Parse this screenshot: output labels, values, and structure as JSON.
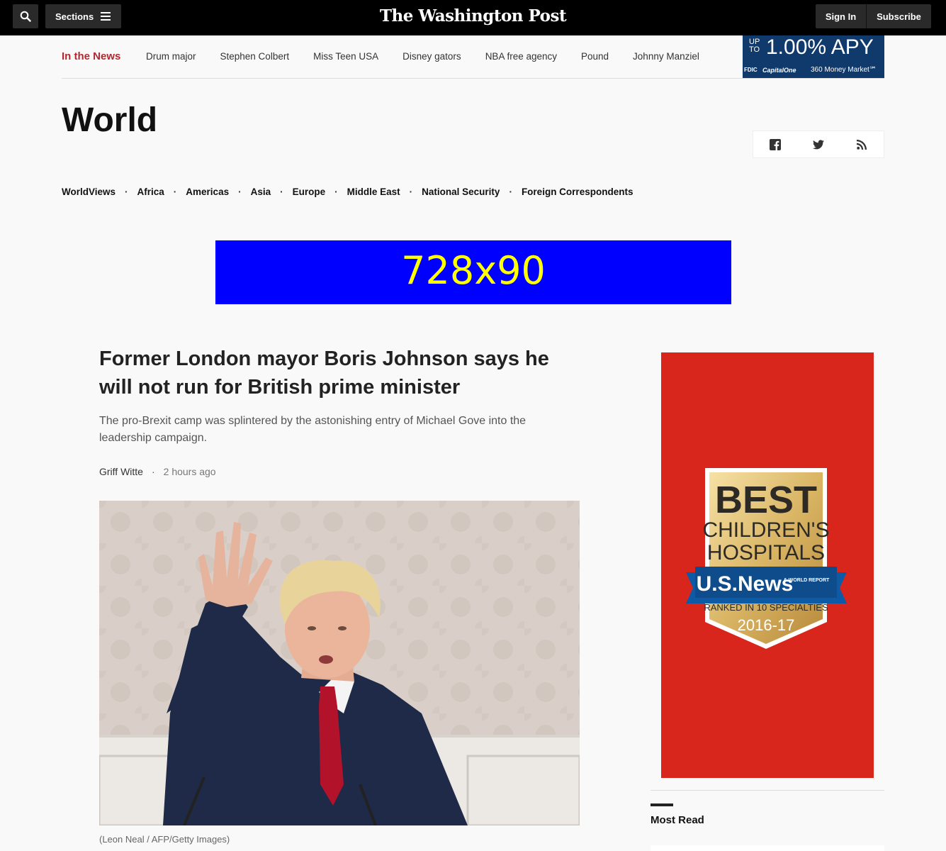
{
  "topbar": {
    "sections_label": "Sections",
    "logo_text": "The Washington Post",
    "signin_label": "Sign In",
    "subscribe_label": "Subscribe"
  },
  "in_the_news": {
    "label": "In the News",
    "links": [
      "Drum major",
      "Stephen Colbert",
      "Miss Teen USA",
      "Disney gators",
      "NBA free agency",
      "Pound",
      "Johnny Manziel"
    ]
  },
  "apy_ad": {
    "up_to": "UP TO",
    "rate": "1.00% APY",
    "fdic": "FDIC",
    "brand": "CapitalOne",
    "product": "360 Money Market℠"
  },
  "section": {
    "title": "World",
    "social": [
      "facebook-icon",
      "twitter-icon",
      "rss-icon"
    ]
  },
  "subnav": [
    "WorldViews",
    "Africa",
    "Americas",
    "Asia",
    "Europe",
    "Middle East",
    "National Security",
    "Foreign Correspondents"
  ],
  "banner_ad": {
    "text": "728x90",
    "bg": "#0000ff",
    "fg": "#ffff00"
  },
  "article": {
    "headline": "Former London mayor Boris Johnson says he will not run for British prime minister",
    "dek": "The pro-Brexit camp was splintered by the astonishing entry of Michael Gove into the leadership campaign.",
    "author": "Griff Witte",
    "time": "2 hours ago",
    "caption": "(Leon Neal / AFP/Getty Images)"
  },
  "rail_ad": {
    "line1": "BEST",
    "line2": "CHILDREN'S",
    "line3": "HOSPITALS",
    "brand": "U.S.News",
    "brand_sub": "& WORLD REPORT",
    "ranked": "RANKED IN 10 SPECIALTIES",
    "year": "2016-17",
    "bg": "#d9261c"
  },
  "most_read": {
    "label": "Most Read"
  },
  "colors": {
    "accent_red": "#b5262d",
    "topbar": "#000000"
  }
}
